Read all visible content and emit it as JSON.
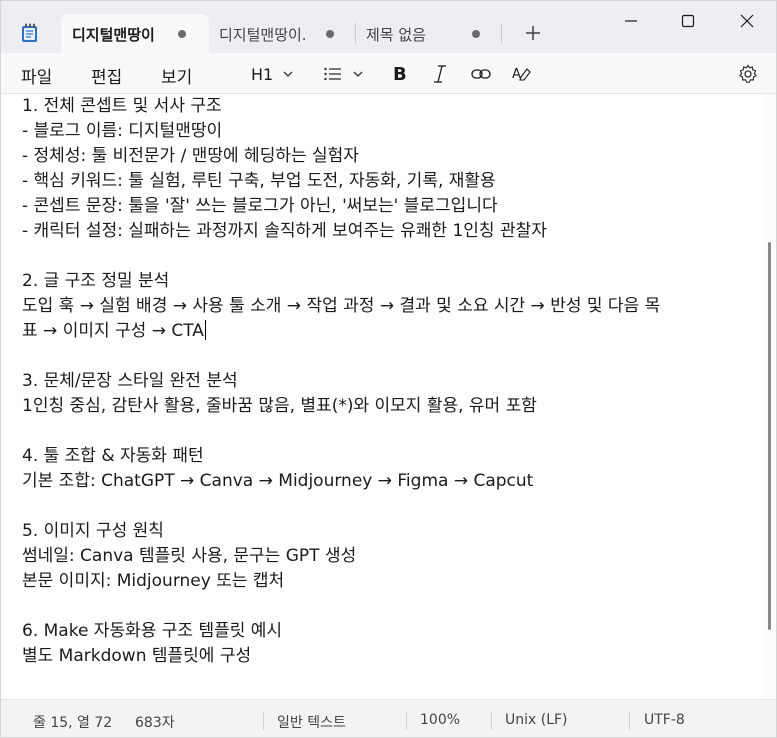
{
  "tabs": [
    {
      "label": "디지털맨땅이",
      "active": true
    },
    {
      "label": "디지털맨땅이.",
      "active": false
    },
    {
      "label": "제목 없음",
      "active": false
    }
  ],
  "window_icons": [
    "notepad-icon",
    "new-tab-icon",
    "minimize-icon",
    "maximize-icon",
    "close-icon"
  ],
  "menu": {
    "file": "파일",
    "edit": "편집",
    "view": "보기",
    "heading": "H1"
  },
  "toolbar_icons": [
    "chevron-down-icon",
    "list-icon",
    "bold-icon",
    "italic-icon",
    "link-icon",
    "clear-format-icon",
    "settings-icon"
  ],
  "document": {
    "lines": [
      "1. 전체 콘셉트 및 서사 구조",
      "- 블로그 이름: 디지털맨땅이",
      "- 정체성: 툴 비전문가 / 맨땅에 헤딩하는 실험자",
      "- 핵심 키워드: 툴 실험, 루틴 구축, 부업 도전, 자동화, 기록, 재활용",
      "- 콘셉트 문장: 툴을 '잘' 쓰는 블로그가 아닌, '써보는' 블로그입니다",
      "- 캐릭터 설정: 실패하는 과정까지 솔직하게 보여주는 유쾌한 1인칭 관찰자",
      "",
      "2. 글 구조 정밀 분석",
      "도입 훅 → 실험 배경 → 사용 툴 소개 → 작업 과정 → 결과 및 소요 시간 → 반성 및 다음 목",
      "표 → 이미지 구성 → CTA",
      "",
      "3. 문체/문장 스타일 완전 분석",
      "1인칭 중심, 감탄사 활용, 줄바꿈 많음, 별표(*)와 이모지 활용, 유머 포함",
      "",
      "4. 툴 조합 & 자동화 패턴",
      "기본 조합: ChatGPT → Canva → Midjourney → Figma → Capcut",
      "",
      "5. 이미지 구성 원칙",
      "썸네일: Canva 템플릿 사용, 문구는 GPT 생성",
      "본문 이미지: Midjourney 또는 캡처",
      "",
      "6. Make 자동화용 구조 템플릿 예시",
      "별도 Markdown 템플릿에 구성"
    ]
  },
  "status": {
    "position": "줄 15, 열 72",
    "chars": "683자",
    "format": "일반 텍스트",
    "zoom": "100%",
    "line_ending": "Unix (LF)",
    "encoding": "UTF-8"
  }
}
